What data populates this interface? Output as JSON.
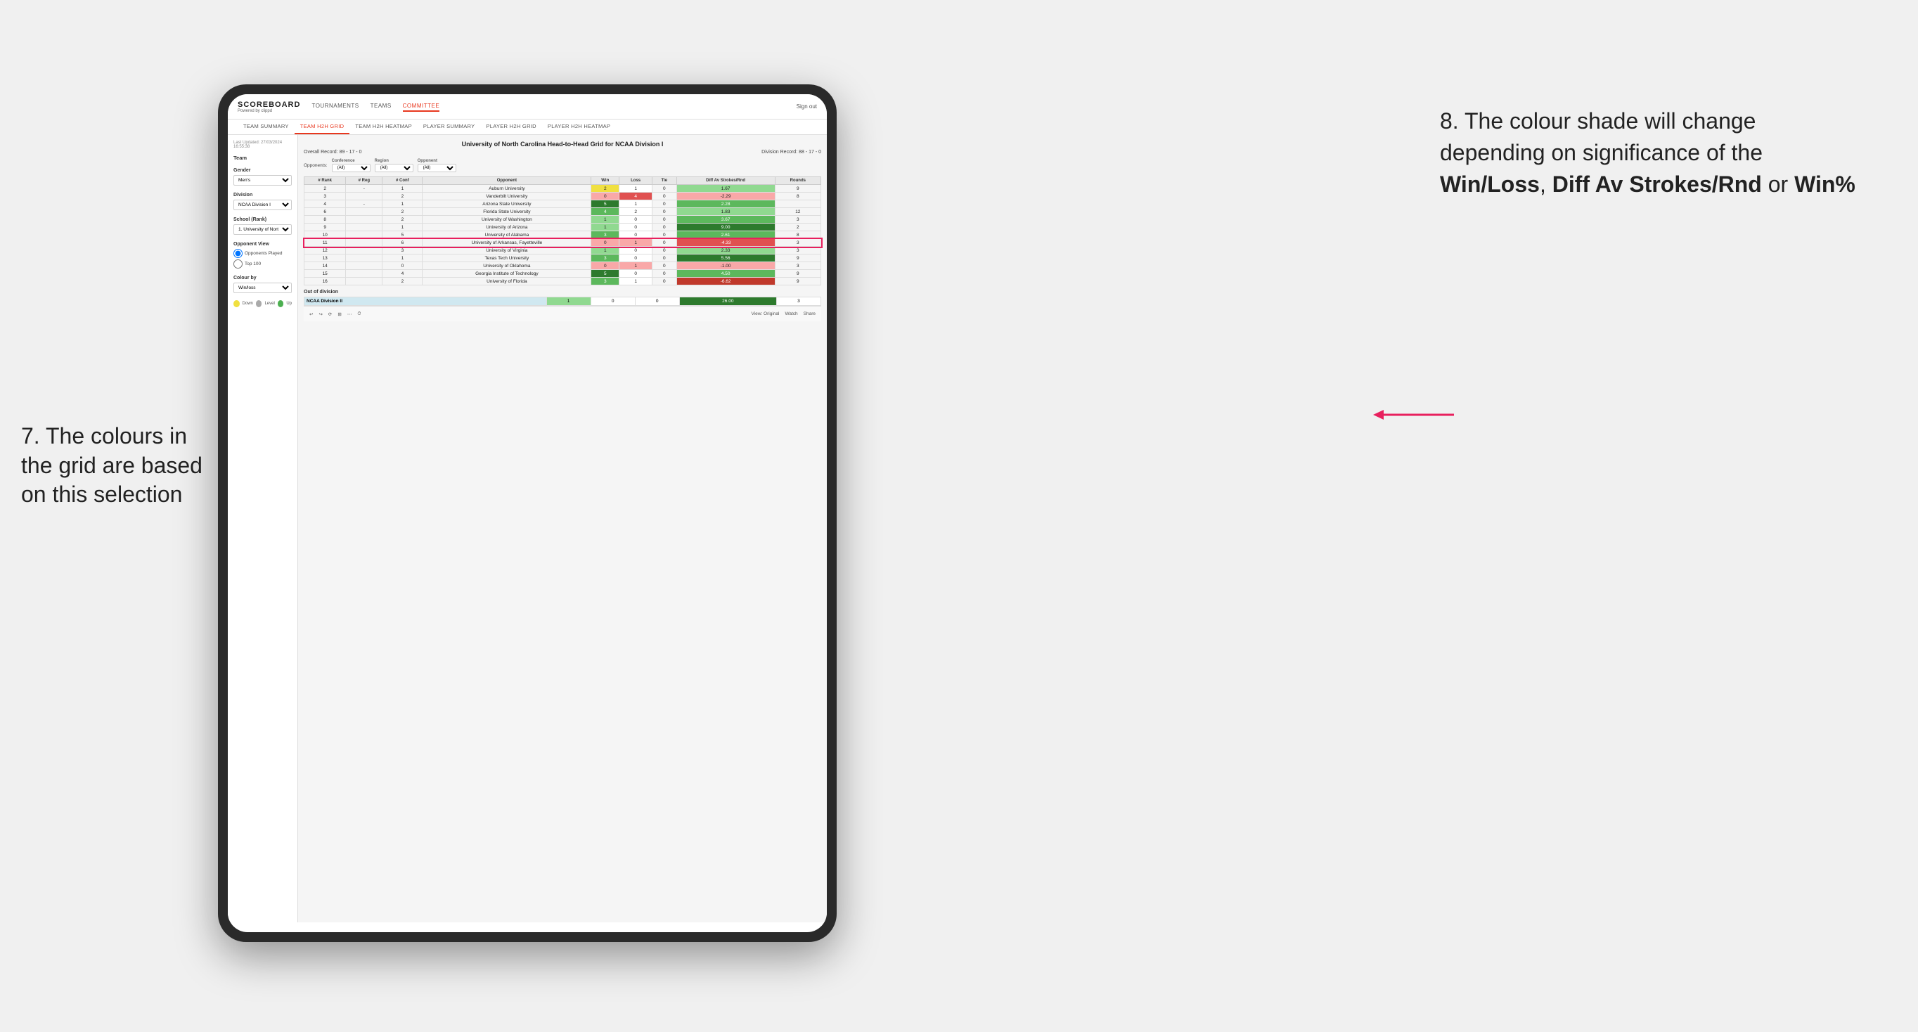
{
  "annotations": {
    "left_text": "7. The colours in the grid are based on this selection",
    "right_text_1": "8. The colour shade will change depending on significance of the ",
    "right_bold_1": "Win/Loss",
    "right_text_2": ", ",
    "right_bold_2": "Diff Av Strokes/Rnd",
    "right_text_3": " or ",
    "right_bold_3": "Win%"
  },
  "header": {
    "logo": "SCOREBOARD",
    "logo_sub": "Powered by clippd",
    "nav": [
      "TOURNAMENTS",
      "TEAMS",
      "COMMITTEE"
    ],
    "sign_out": "Sign out"
  },
  "subnav": [
    "TEAM SUMMARY",
    "TEAM H2H GRID",
    "TEAM H2H HEATMAP",
    "PLAYER SUMMARY",
    "PLAYER H2H GRID",
    "PLAYER H2H HEATMAP"
  ],
  "subnav_active": "TEAM H2H GRID",
  "sidebar": {
    "timestamp": "Last Updated: 27/03/2024 16:55:38",
    "team_label": "Team",
    "gender_label": "Gender",
    "gender_value": "Men's",
    "division_label": "Division",
    "division_value": "NCAA Division I",
    "school_label": "School (Rank)",
    "school_value": "1. University of Nort...",
    "opponent_view_label": "Opponent View",
    "radio_opponents": "Opponents Played",
    "radio_top100": "Top 100",
    "colour_by_label": "Colour by",
    "colour_by_value": "Win/loss",
    "legend_down": "Down",
    "legend_level": "Level",
    "legend_up": "Up"
  },
  "grid": {
    "title": "University of North Carolina Head-to-Head Grid for NCAA Division I",
    "overall_record": "Overall Record: 89 - 17 - 0",
    "division_record": "Division Record: 88 - 17 - 0",
    "filters": {
      "conference_label": "Conference",
      "conference_value": "(All)",
      "region_label": "Region",
      "region_value": "(All)",
      "opponent_label": "Opponent",
      "opponent_value": "(All)"
    },
    "columns": [
      "# Rank",
      "# Reg",
      "# Conf",
      "Opponent",
      "Win",
      "Loss",
      "Tie",
      "Diff Av Strokes/Rnd",
      "Rounds"
    ],
    "rows": [
      {
        "rank": "2",
        "reg": "-",
        "conf": "1",
        "opponent": "Auburn University",
        "win": "2",
        "loss": "1",
        "tie": "0",
        "diff": "1.67",
        "rounds": "9",
        "win_color": "yellow",
        "loss_color": "white",
        "diff_color": "green_light"
      },
      {
        "rank": "3",
        "reg": "",
        "conf": "2",
        "opponent": "Vanderbilt University",
        "win": "0",
        "loss": "4",
        "tie": "0",
        "diff": "-2.29",
        "rounds": "8",
        "win_color": "red_light",
        "loss_color": "red_med",
        "diff_color": "red_light"
      },
      {
        "rank": "4",
        "reg": "-",
        "conf": "1",
        "opponent": "Arizona State University",
        "win": "5",
        "loss": "1",
        "tie": "0",
        "diff": "2.28",
        "rounds": "",
        "win_color": "green_dark",
        "loss_color": "white",
        "diff_color": "green_med"
      },
      {
        "rank": "6",
        "reg": "",
        "conf": "2",
        "opponent": "Florida State University",
        "win": "4",
        "loss": "2",
        "tie": "0",
        "diff": "1.83",
        "rounds": "12",
        "win_color": "green_med",
        "loss_color": "white",
        "diff_color": "green_light"
      },
      {
        "rank": "8",
        "reg": "",
        "conf": "2",
        "opponent": "University of Washington",
        "win": "1",
        "loss": "0",
        "tie": "0",
        "diff": "3.67",
        "rounds": "3",
        "win_color": "green_light",
        "loss_color": "white",
        "diff_color": "green_med"
      },
      {
        "rank": "9",
        "reg": "",
        "conf": "1",
        "opponent": "University of Arizona",
        "win": "1",
        "loss": "0",
        "tie": "0",
        "diff": "9.00",
        "rounds": "2",
        "win_color": "green_light",
        "loss_color": "white",
        "diff_color": "green_dark"
      },
      {
        "rank": "10",
        "reg": "",
        "conf": "5",
        "opponent": "University of Alabama",
        "win": "3",
        "loss": "0",
        "tie": "0",
        "diff": "2.61",
        "rounds": "8",
        "win_color": "green_med",
        "loss_color": "white",
        "diff_color": "green_med"
      },
      {
        "rank": "11",
        "reg": "",
        "conf": "6",
        "opponent": "University of Arkansas, Fayetteville",
        "win": "0",
        "loss": "1",
        "tie": "0",
        "diff": "-4.33",
        "rounds": "3",
        "win_color": "red_light",
        "loss_color": "red_light",
        "diff_color": "red_med",
        "highlighted": true
      },
      {
        "rank": "12",
        "reg": "",
        "conf": "3",
        "opponent": "University of Virginia",
        "win": "1",
        "loss": "0",
        "tie": "0",
        "diff": "2.33",
        "rounds": "3",
        "win_color": "green_light",
        "loss_color": "white",
        "diff_color": "green_light"
      },
      {
        "rank": "13",
        "reg": "",
        "conf": "1",
        "opponent": "Texas Tech University",
        "win": "3",
        "loss": "0",
        "tie": "0",
        "diff": "5.56",
        "rounds": "9",
        "win_color": "green_med",
        "loss_color": "white",
        "diff_color": "green_dark"
      },
      {
        "rank": "14",
        "reg": "",
        "conf": "0",
        "opponent": "University of Oklahoma",
        "win": "0",
        "loss": "1",
        "tie": "0",
        "diff": "-1.00",
        "rounds": "3",
        "win_color": "red_light",
        "loss_color": "red_light",
        "diff_color": "red_light"
      },
      {
        "rank": "15",
        "reg": "",
        "conf": "4",
        "opponent": "Georgia Institute of Technology",
        "win": "5",
        "loss": "0",
        "tie": "0",
        "diff": "4.50",
        "rounds": "9",
        "win_color": "green_dark",
        "loss_color": "white",
        "diff_color": "green_med"
      },
      {
        "rank": "16",
        "reg": "",
        "conf": "2",
        "opponent": "University of Florida",
        "win": "3",
        "loss": "1",
        "tie": "0",
        "diff": "-6.62",
        "rounds": "9",
        "win_color": "green_med",
        "loss_color": "white",
        "diff_color": "red_dark"
      }
    ],
    "out_of_division": {
      "label": "Out of division",
      "row": {
        "name": "NCAA Division II",
        "win": "1",
        "loss": "0",
        "tie": "0",
        "diff": "26.00",
        "rounds": "3"
      }
    }
  },
  "toolbar": {
    "view_label": "View: Original",
    "watch_label": "Watch",
    "share_label": "Share"
  }
}
